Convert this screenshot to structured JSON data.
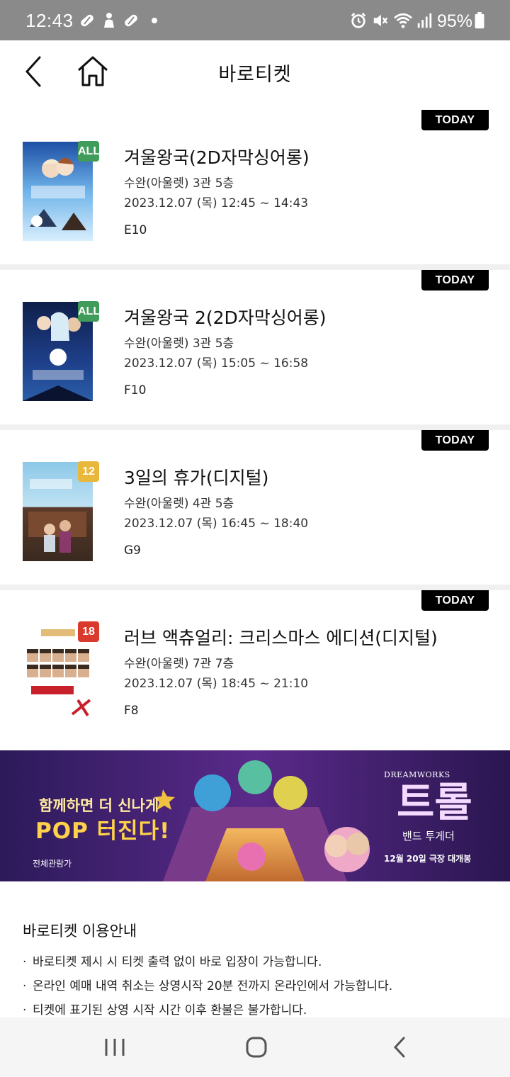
{
  "status_bar": {
    "time": "12:43",
    "battery": "95%",
    "left_icons": [
      "pill-icon",
      "person-icon",
      "pill-icon",
      "dot-icon"
    ],
    "right_icons": [
      "alarm-icon",
      "mute-icon",
      "wifi-icon",
      "signal-icon",
      "battery-icon"
    ]
  },
  "header": {
    "title": "바로티켓",
    "back_icon": "chevron-left-icon",
    "home_icon": "home-icon"
  },
  "tickets": [
    {
      "badge": "TODAY",
      "rating": "ALL",
      "rating_color": "#3f9c5a",
      "title": "겨울왕국(2D자막싱어롱)",
      "venue": "수완(아울렛) 3관 5층",
      "time": "2023.12.07 (목) 12:45 ~ 14:43",
      "seat": "E10",
      "poster": "poster-frozen"
    },
    {
      "badge": "TODAY",
      "rating": "ALL",
      "rating_color": "#3f9c5a",
      "title": "겨울왕국 2(2D자막싱어롱)",
      "venue": "수완(아울렛) 3관 5층",
      "time": "2023.12.07 (목) 15:05 ~ 16:58",
      "seat": "F10",
      "poster": "poster-frozen2"
    },
    {
      "badge": "TODAY",
      "rating": "12",
      "rating_color": "#e9b73a",
      "title": "3일의 휴가(디지털)",
      "venue": "수완(아울렛) 4관 5층",
      "time": "2023.12.07 (목) 16:45 ~ 18:40",
      "seat": "G9",
      "poster": "poster-3days"
    },
    {
      "badge": "TODAY",
      "rating": "18",
      "rating_color": "#d93a2b",
      "title": "러브 액츄얼리: 크리스마스 에디션(디지털)",
      "venue": "수완(아울렛) 7관 7층",
      "time": "2023.12.07 (목) 18:45 ~ 21:10",
      "seat": "F8",
      "poster": "poster-love-actually"
    }
  ],
  "banner": {
    "headline_1": "함께하면 더 신나게",
    "headline_2": "POP 터진다!",
    "rating_text": "전체관람가",
    "brand": "DREAMWORKS",
    "movie_title": "트롤",
    "movie_subtitle": "밴드 투게더",
    "release": "12월 20일 극장 대개봉"
  },
  "guide": {
    "title": "바로티켓 이용안내",
    "items": [
      "바로티켓 제시 시 티켓 출력 없이 바로 입장이 가능합니다.",
      "온라인 예매 내역 취소는 상영시작 20분 전까지 온라인에서 가능합니다.",
      "티켓에 표기된 상영 시작 시간 이후 환불은 불가합니다."
    ]
  },
  "nav_bar": {
    "icons": [
      "recents-icon",
      "home-button-icon",
      "back-icon"
    ]
  },
  "colors": {
    "status_bar": "#8a8a8a",
    "badge": "#000000",
    "divider": "#f0f0f0",
    "banner_bg": "#3a2068"
  }
}
